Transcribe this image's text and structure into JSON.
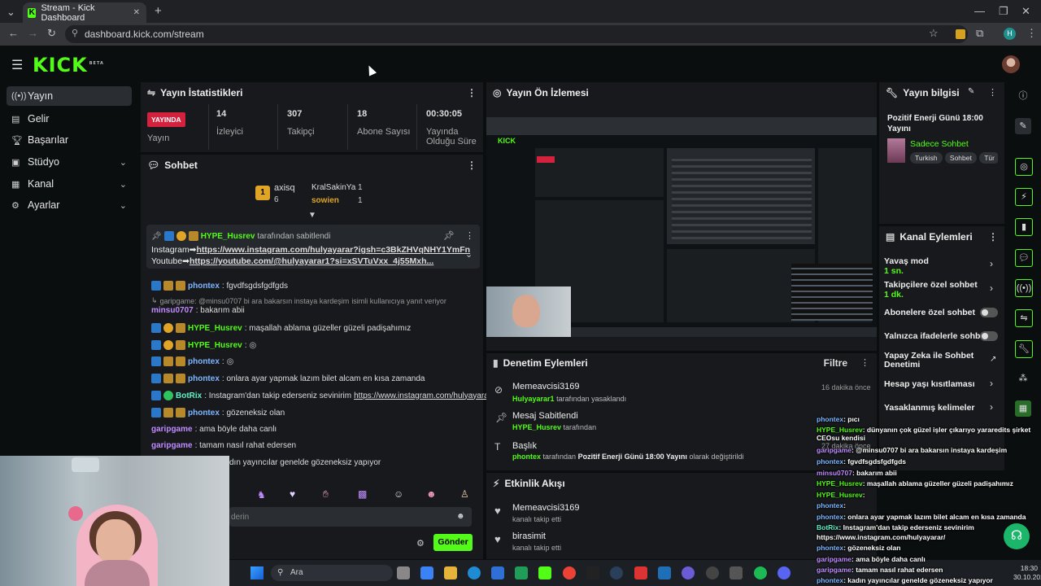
{
  "browser": {
    "tab_title": "Stream - Kick Dashboard",
    "url": "dashboard.kick.com/stream",
    "new_tab": "+",
    "close_tab": "✕",
    "profile_initial": "H"
  },
  "brand": {
    "logo": "KICK",
    "beta": "BETA"
  },
  "sidebar": {
    "items": [
      {
        "label": "Yayın",
        "icon": "broadcast-icon"
      },
      {
        "label": "Gelir",
        "icon": "wallet-icon"
      },
      {
        "label": "Başarılar",
        "icon": "trophy-icon"
      },
      {
        "label": "Stüdyo",
        "icon": "camera-icon"
      },
      {
        "label": "Kanal",
        "icon": "channel-icon"
      },
      {
        "label": "Ayarlar",
        "icon": "gear-icon"
      }
    ]
  },
  "stats": {
    "title": "Yayın İstatistikleri",
    "live_badge": "YAYINDA",
    "live_label": "Yayın",
    "viewers": "14",
    "viewers_label": "İzleyici",
    "followers": "307",
    "followers_label": "Takipçi",
    "subs": "18",
    "subs_label": "Abone Sayısı",
    "uptime": "00:30:05",
    "uptime_label": "Yayında Olduğu Süre"
  },
  "chat": {
    "title": "Sohbet",
    "top_gifters": [
      {
        "name": "axisq",
        "count": "6"
      },
      {
        "name": "KralSakinYa",
        "count": "1"
      },
      {
        "name": "sowien",
        "count": "1"
      }
    ],
    "pinned": {
      "user": "HYPE_Husrev",
      "suffix": "tarafından sabitlendi",
      "line1_prefix": "Instagram➡",
      "line1_link": "https://www.instagram.com/hulyayarar?igsh=c3BkZHVqNHY1YmFn",
      "line2_prefix": "Youtube➡",
      "line2_link": "https://youtube.com/@hulyayarar1?si=xSVTuVxx_4j55Mxh..."
    },
    "reply_hint": "garipgame: @minsu0707 bi ara bakarsın instaya kardeşim",
    "reply_suffix": "isimli kullanıcıya yanıt veriyor",
    "messages": [
      {
        "user": "phontex",
        "text": ": fgvdfsgdsfgdfgds"
      },
      {
        "user": "minsu0707",
        "text": ": bakarım abii"
      },
      {
        "user": "HYPE_Husrev",
        "text": ": maşallah ablama güzeller güzeli padişahımız"
      },
      {
        "user": "HYPE_Husrev",
        "text": ":"
      },
      {
        "user": "phontex",
        "text": ":"
      },
      {
        "user": "phontex",
        "text": ": onlara ayar yapmak lazım bilet alcam en kısa zamanda"
      },
      {
        "user": "BotRix",
        "text": ": Instagram'dan takip ederseniz sevinirim",
        "link": "https://www.instagram.com/hulyayarar/"
      },
      {
        "user": "phontex",
        "text": ": gözeneksiz olan"
      },
      {
        "user": "garipgame",
        "text": ": ama böyle daha canlı"
      },
      {
        "user": "garipgame",
        "text": ": tamam nasıl rahat edersen"
      },
      {
        "user": "",
        "text": "dın yayıncılar genelde gözeneksiz yapıyor"
      }
    ],
    "input_placeholder": "derin",
    "send": "Gönder"
  },
  "preview": {
    "title": "Yayın Ön İzlemesi"
  },
  "moderation": {
    "title": "Denetim Eylemleri",
    "filter": "Filtre",
    "items": [
      {
        "title": "Memeavcisi3169",
        "sub_user": "Hulyayarar1",
        "sub_text": "tarafından yasaklandı",
        "time": "16 dakika önce"
      },
      {
        "title": "Mesaj Sabitlendi",
        "sub_user": "HYPE_Husrev",
        "sub_text": "tarafından",
        "time": ""
      },
      {
        "title": "Başlık",
        "sub_user": "phontex",
        "sub_text": "tarafından",
        "sub_bold": "Pozitif Enerji Günü 18:00 Yayını",
        "sub_tail": "olarak değiştirildi",
        "time": "27 dakika önce"
      }
    ]
  },
  "activity": {
    "title": "Etkinlik Akışı",
    "items": [
      {
        "user": "Memeavcisi3169",
        "text": "kanalı takip etti"
      },
      {
        "user": "birasimit",
        "text": "kanalı takip etti"
      }
    ]
  },
  "stream_info": {
    "title": "Yayın bilgisi",
    "stream_title": "Pozitif Enerji Günü 18:00 Yayını",
    "category": "Sadece Sohbet",
    "tags": [
      "Turkish",
      "Sohbet",
      "Tür"
    ]
  },
  "channel_actions": {
    "title": "Kanal Eylemleri",
    "slow_mode": "Yavaş mod",
    "slow_mode_val": "1 sn.",
    "followers_only": "Takipçilere özel sohbet",
    "followers_only_val": "1 dk.",
    "subs_only": "Abonelere özel sohbet",
    "emotes_only": "Yalnızca ifadelerle sohbet",
    "ai_mod": "Yapay Zeka ile Sohbet Denetimi",
    "age_restrict": "Hesap yaşı kısıtlaması",
    "banned_words": "Yasaklanmış kelimeler"
  },
  "overlay_chat": [
    {
      "user": "phontex",
      "text": ": pıcı"
    },
    {
      "user": "HYPE_Husrev",
      "text": ": dünyanın çok güzel işler çıkarıyo yararedits şirket CEOsu kendisi"
    },
    {
      "user": "garipgame",
      "text": ": @minsu0707 bi ara bakarsın instaya kardeşim"
    },
    {
      "user": "phontex",
      "text": ": fgvdfsgdsfgdfgds"
    },
    {
      "user": "minsu0707",
      "text": ": bakarım abii"
    },
    {
      "user": "HYPE_Husrev",
      "text": ": maşallah ablama güzeller güzeli padişahımız"
    },
    {
      "user": "HYPE_Husrev",
      "text": ":"
    },
    {
      "user": "phontex",
      "text": ":"
    },
    {
      "user": "phontex",
      "text": ": onlara ayar yapmak lazım bilet alcam en kısa zamanda"
    },
    {
      "user": "BotRix",
      "text": ": Instagram'dan takip ederseniz sevinirim"
    },
    {
      "user": "",
      "text": "https://www.instagram.com/hulyayarar/"
    },
    {
      "user": "phontex",
      "text": ": gözeneksiz olan"
    },
    {
      "user": "garipgame",
      "text": ": ama böyle daha canlı"
    },
    {
      "user": "garipgame",
      "text": ": tamam nasıl rahat edersen"
    },
    {
      "user": "phontex",
      "text": ": kadın yayıncılar genelde gözeneksiz yapıyor"
    }
  ],
  "taskbar": {
    "search": "Ara",
    "time": "18:30",
    "date": "30.10.2025"
  },
  "colors": {
    "kick_green": "#53fc18",
    "live_red": "#d4213e"
  }
}
